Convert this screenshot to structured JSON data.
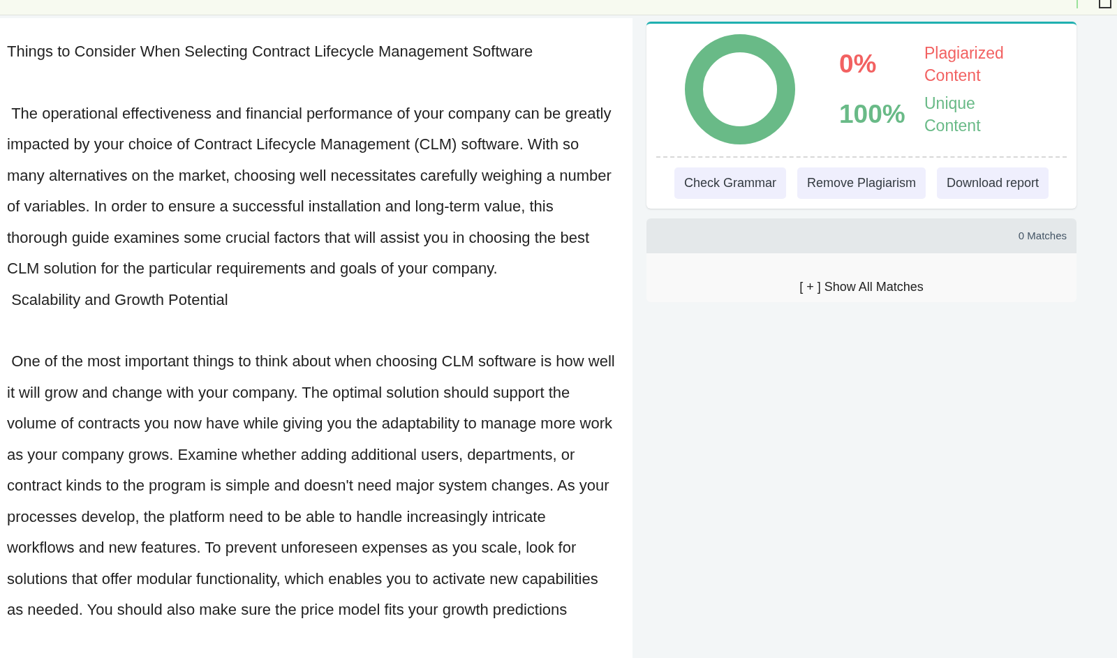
{
  "document": {
    "title": "Things to Consider When Selecting Contract Lifecycle Management Software",
    "blocks": [
      {
        "kind": "paragraph",
        "text": " The operational effectiveness and financial performance of your company can be greatly impacted by your choice of Contract Lifecycle Management (CLM) software. With so many alternatives on the market, choosing well necessitates carefully weighing a number of variables. In order to ensure a successful installation and long-term value, this thorough guide examines some crucial factors that will assist you in choosing the best CLM solution for the particular requirements and goals of your company."
      },
      {
        "kind": "heading",
        "text": " Scalability and Growth Potential"
      },
      {
        "kind": "paragraph",
        "text": " One of the most important things to think about when choosing CLM software is how well it will grow and change with your company. The optimal solution should support the volume of contracts you now have while giving you the adaptability to manage more work as your company grows. Examine whether adding additional users, departments, or contract kinds to the program is simple and doesn't need major system changes. As your processes develop, the platform need to be able to handle increasingly intricate workflows and new features. To prevent unforeseen expenses as you scale, look for solutions that offer modular functionality, which enables you to activate new capabilities as needed. You should also make sure the price model fits your growth predictions"
      }
    ]
  },
  "result": {
    "stats": [
      {
        "value": "0%",
        "label": "Plagiarized Content",
        "color": "#f26161"
      },
      {
        "value": "100%",
        "label": "Unique Content",
        "color": "#69ba87"
      }
    ],
    "buttons": [
      "Check Grammar",
      "Remove Plagiarism",
      "Download report"
    ]
  },
  "matches": {
    "count": "0 Matches",
    "toggle": "[ + ] Show All Matches"
  }
}
